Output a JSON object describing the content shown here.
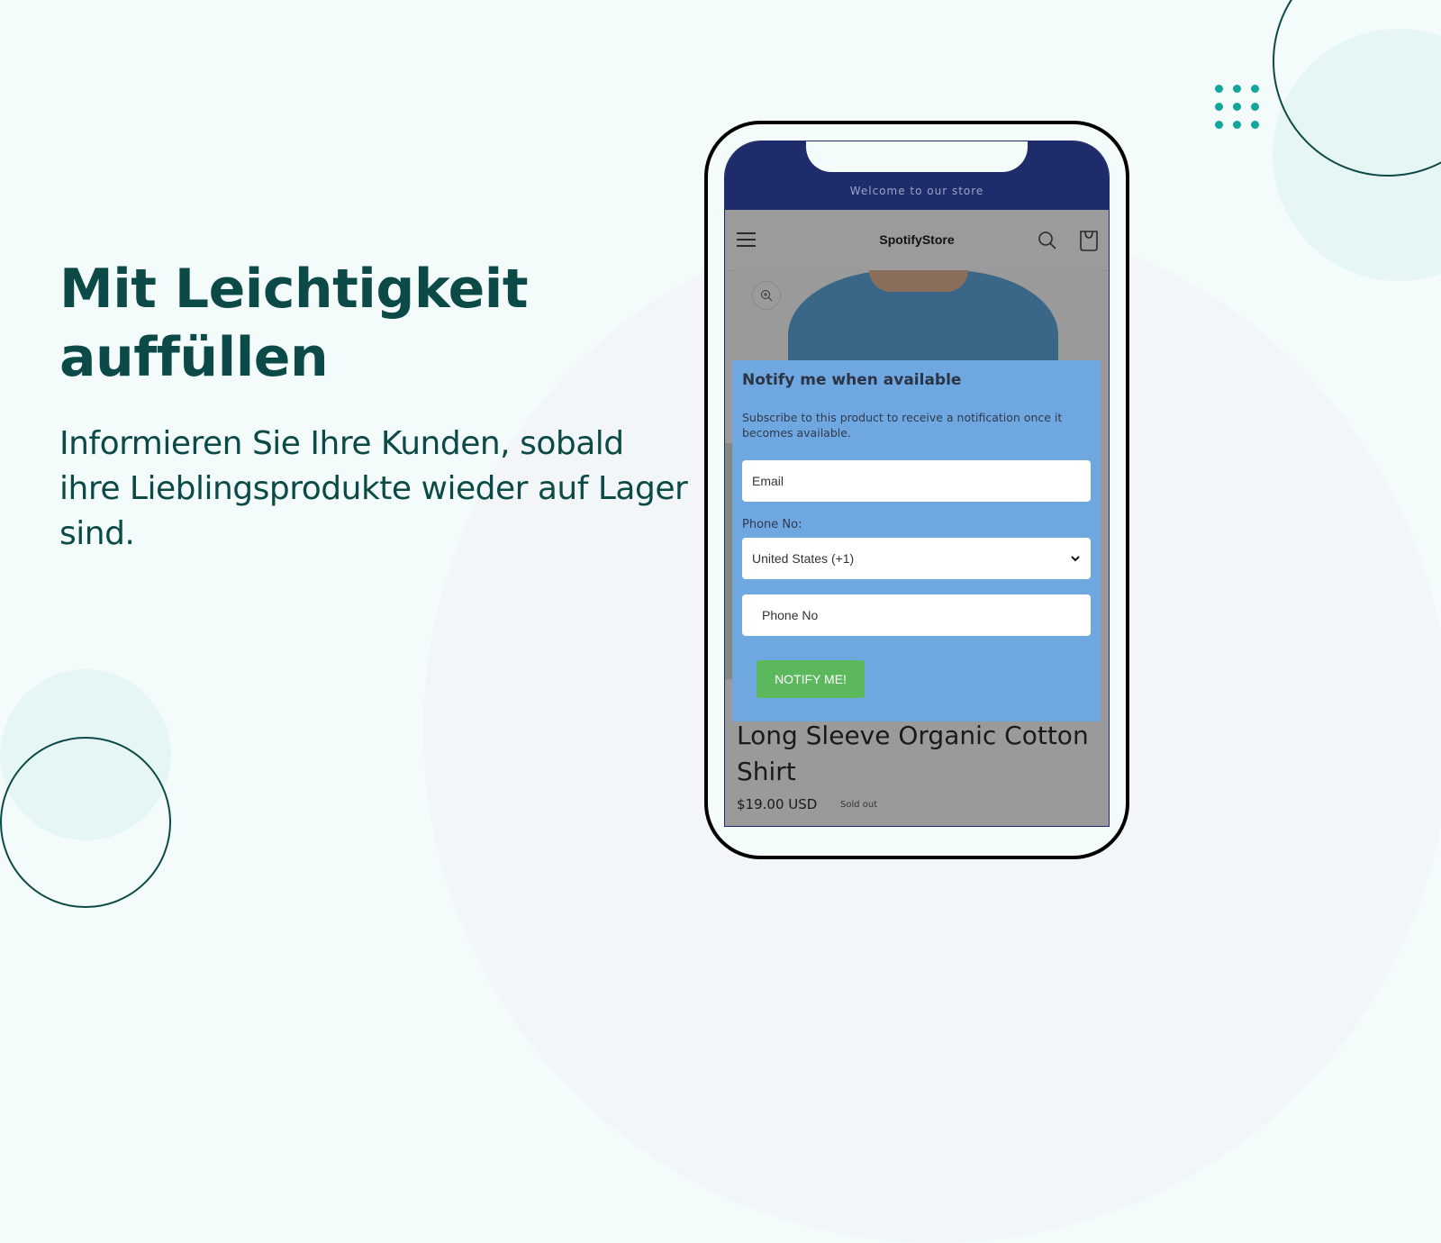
{
  "hero": {
    "headline": "Mit Leichtigkeit auffüllen",
    "subtext": "Informieren Sie Ihre Kunden, sobald ihre Lieblingsprodukte wieder auf Lager sind."
  },
  "colors": {
    "brand_dark": "#0c4a47",
    "dot_accent": "#13a59c",
    "announce_bar": "#1f2c6b",
    "modal_bg": "#6fa8e0",
    "notify_button": "#5cb85c"
  },
  "phone": {
    "announcement": "Welcome to our store",
    "store_name": "SpotifyStore",
    "icons": {
      "menu": "hamburger-menu-icon",
      "search": "search-icon",
      "cart": "cart-icon",
      "zoom": "zoom-in-icon"
    },
    "modal": {
      "title": "Notify me when available",
      "description": "Subscribe to this product to receive a notification once it becomes available.",
      "email_placeholder": "Email",
      "phone_label": "Phone No:",
      "country_selected": "United States (+1)",
      "phone_placeholder": "Phone No",
      "button_label": "NOTIFY ME!"
    },
    "product": {
      "title": "Long Sleeve Organic Cotton Shirt",
      "price": "$19.00 USD",
      "status": "Sold out"
    }
  }
}
